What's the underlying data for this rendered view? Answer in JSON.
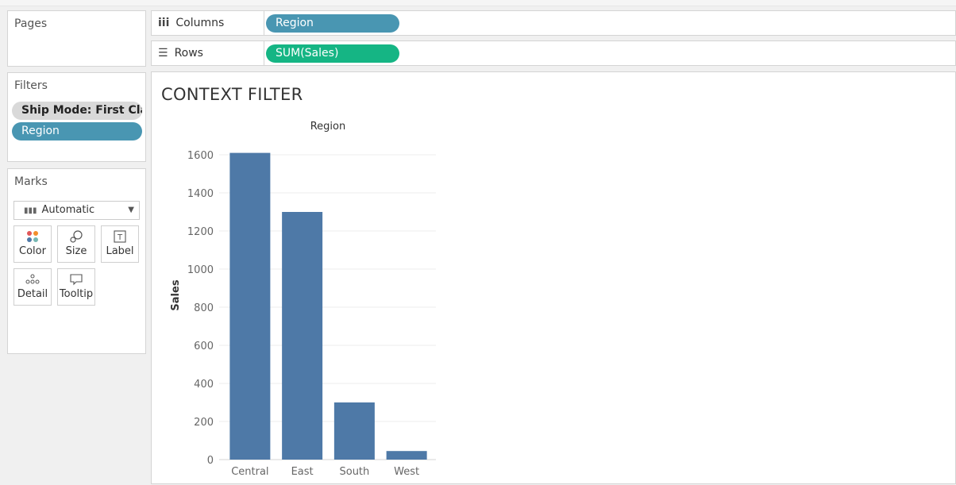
{
  "pages": {
    "title": "Pages"
  },
  "filters": {
    "title": "Filters",
    "items": [
      "Ship Mode: First Cla..",
      "Region"
    ]
  },
  "marks": {
    "title": "Marks",
    "type_label": "Automatic",
    "buttons": [
      "Color",
      "Size",
      "Label",
      "Detail",
      "Tooltip"
    ]
  },
  "shelves": {
    "columns": {
      "label": "Columns",
      "pill": "Region"
    },
    "rows": {
      "label": "Rows",
      "pill": "SUM(Sales)"
    }
  },
  "view": {
    "title": "CONTEXT FILTER"
  },
  "colors": {
    "bar": "#4e79a7",
    "pill_blue": "#4996b2",
    "pill_green": "#15b584"
  },
  "chart_data": {
    "type": "bar",
    "title": "Region",
    "xlabel": "",
    "ylabel": "Sales",
    "categories": [
      "Central",
      "East",
      "South",
      "West"
    ],
    "values": [
      1610,
      1300,
      300,
      45
    ],
    "ylim": [
      0,
      1700
    ],
    "yticks": [
      0,
      200,
      400,
      600,
      800,
      1000,
      1200,
      1400,
      1600
    ],
    "grid": true
  }
}
